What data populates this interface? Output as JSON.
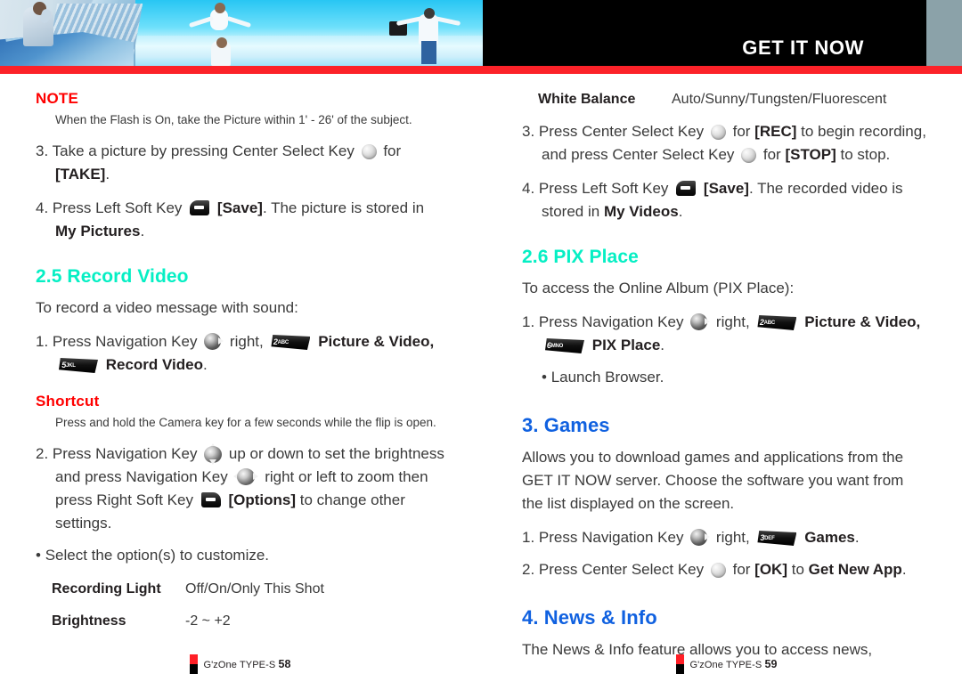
{
  "header": {
    "title": "GET IT NOW",
    "photo_alt": "header-banner-photo"
  },
  "left_column": {
    "note": {
      "heading": "NOTE",
      "body": "When the Flash is On, take the Picture within 1' - 26' of the subject."
    },
    "step3": {
      "num": "3.",
      "t1": "Take a picture by pressing Center Select Key",
      "t2": "for",
      "t3": "[TAKE]",
      "t4": "."
    },
    "step4": {
      "num": "4.",
      "t1": "Press Left Soft Key",
      "t2": "[Save]",
      "t3": ". The picture is stored in",
      "t4": "My Pictures",
      "t5": "."
    },
    "section_record_video": {
      "heading": "2.5 Record Video",
      "intro": "To record a video message with sound:",
      "step1": {
        "num": "1.",
        "t1": "Press Navigation Key",
        "t2": "right,",
        "key_a": {
          "digit": "2",
          "letters": "ABC"
        },
        "t3": "Picture & Video,",
        "key_b": {
          "digit": "5",
          "letters": "JKL"
        },
        "t4": "Record Video",
        "t5": "."
      },
      "shortcut": {
        "heading": "Shortcut",
        "body": "Press and hold the Camera key for a few seconds while the flip is open."
      },
      "step2": {
        "num": "2.",
        "t1": "Press Navigation Key",
        "t2": "up or down to set the brightness and press Navigation Key",
        "t3": "right or left to zoom then press Right Soft Key",
        "t4": "[Options]",
        "t5": "to change other settings."
      },
      "bullet": "Select the option(s) to customize.",
      "specs": [
        {
          "key": "Recording Light",
          "value": "Off/On/Only This Shot"
        },
        {
          "key": "Brightness",
          "value": "-2 ~ +2"
        }
      ]
    },
    "footer": {
      "book": "G'zOne TYPE-S",
      "page": "58"
    }
  },
  "right_column": {
    "spec_top": {
      "key": "White Balance",
      "value": "Auto/Sunny/Tungsten/Fluorescent"
    },
    "step3": {
      "num": "3.",
      "t1": "Press Center Select Key",
      "t2": "for",
      "t3": "[REC]",
      "t4": "to begin recording, and press Center Select Key",
      "t5": "for",
      "t6": "[STOP]",
      "t7": "to stop."
    },
    "step4": {
      "num": "4.",
      "t1": "Press Left Soft Key",
      "t2": "[Save]",
      "t3": ". The recorded video is stored in",
      "t4": "My Videos",
      "t5": "."
    },
    "section_pix_place": {
      "heading": "2.6 PIX Place",
      "intro": "To access the Online Album (PIX Place):",
      "step1": {
        "num": "1.",
        "t1": "Press Navigation Key",
        "t2": "right,",
        "key_a": {
          "digit": "2",
          "letters": "ABC"
        },
        "t3": "Picture & Video,",
        "key_b": {
          "digit": "6",
          "letters": "MNO"
        },
        "t4": "PIX Place",
        "t5": "."
      },
      "bullet": "Launch Browser."
    },
    "section_games": {
      "heading": "3. Games",
      "para": "Allows you to download games and applications  from the GET IT NOW server. Choose the software you want from the list displayed on the screen.",
      "step1": {
        "num": "1.",
        "t1": "Press Navigation Key",
        "t2": "right,",
        "key_a": {
          "digit": "3",
          "letters": "DEF"
        },
        "t3": "Games",
        "t4": "."
      },
      "step2": {
        "num": "2.",
        "t1": "Press Center Select Key",
        "t2": "for",
        "t3": "[OK]",
        "t4": "to",
        "t5": "Get New App",
        "t6": "."
      }
    },
    "section_news_info": {
      "heading": "4. News & Info",
      "para": "The News & Info feature allows you to access news,"
    },
    "footer": {
      "book": "G'zOne TYPE-S",
      "page": "59"
    }
  },
  "colors": {
    "red": "#fc2229",
    "teal": "#05efc4",
    "blue": "#1061e0",
    "black": "#000000",
    "gray": "#8ba2a9"
  }
}
